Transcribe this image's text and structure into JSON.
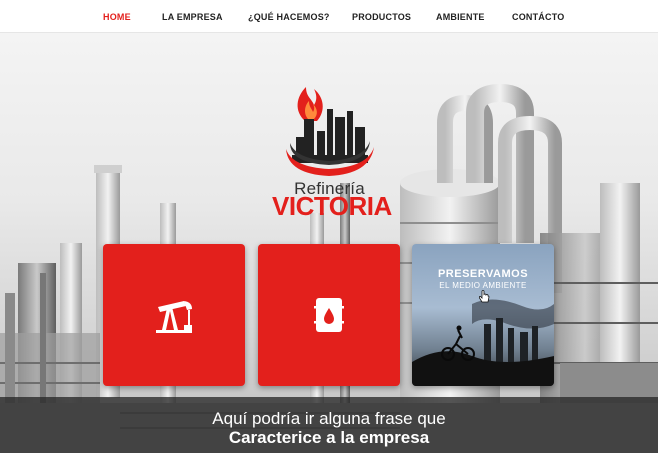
{
  "nav": {
    "items": [
      {
        "label": "HOME",
        "active": true
      },
      {
        "label": "LA EMPRESA",
        "active": false
      },
      {
        "label": "¿QUÉ HACEMOS?",
        "active": false
      },
      {
        "label": "PRODUCTOS",
        "active": false
      },
      {
        "label": "AMBIENTE",
        "active": false
      },
      {
        "label": "CONTÁCTO",
        "active": false
      }
    ]
  },
  "logo": {
    "line1": "Refinería",
    "line2": "VICTORIA"
  },
  "tiles": [
    {
      "icon": "oil-pump-icon"
    },
    {
      "icon": "oil-barrel-icon"
    },
    {
      "title": "PRESERVAMOS",
      "subtitle": "EL MEDIO AMBIENTE",
      "icon": "hand-pointer-icon"
    }
  ],
  "banner": {
    "line1": "Aquí podría ir alguna frase que",
    "line2": "Caracterice a la empresa"
  },
  "colors": {
    "accent": "#e3201c",
    "nav_text": "#222222",
    "band": "#282828"
  }
}
